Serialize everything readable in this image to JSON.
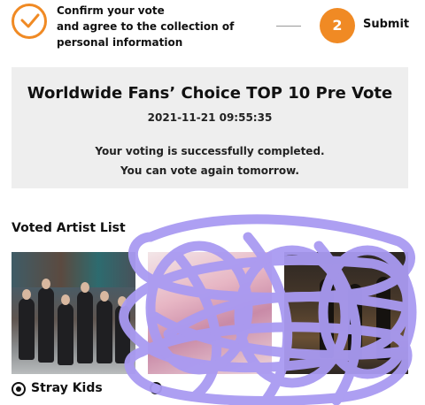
{
  "steps": {
    "step1_line1": "Confirm your vote",
    "step1_line2": "and agree to the collection of",
    "step1_line3": "personal information",
    "step2_number": "2",
    "step2_label": "Submit"
  },
  "completion": {
    "title": "Worldwide Fans’ Choice TOP 10 Pre Vote",
    "timestamp": "2021-11-21 09:55:35",
    "message_line1": "Your voting is successfully completed.",
    "message_line2": "You can vote again tomorrow."
  },
  "voted_list": {
    "title": "Voted Artist List",
    "artists": [
      {
        "name": "Stray Kids",
        "selected": true
      },
      {
        "name": "",
        "selected": false
      },
      {
        "name": "",
        "selected": false
      }
    ]
  },
  "colors": {
    "accent": "#f08a24",
    "scribble": "#a99af2",
    "box_bg": "#eeeeee"
  },
  "icons": {
    "step1": "checkmark-icon",
    "radio_selected": "radio-selected-icon"
  }
}
